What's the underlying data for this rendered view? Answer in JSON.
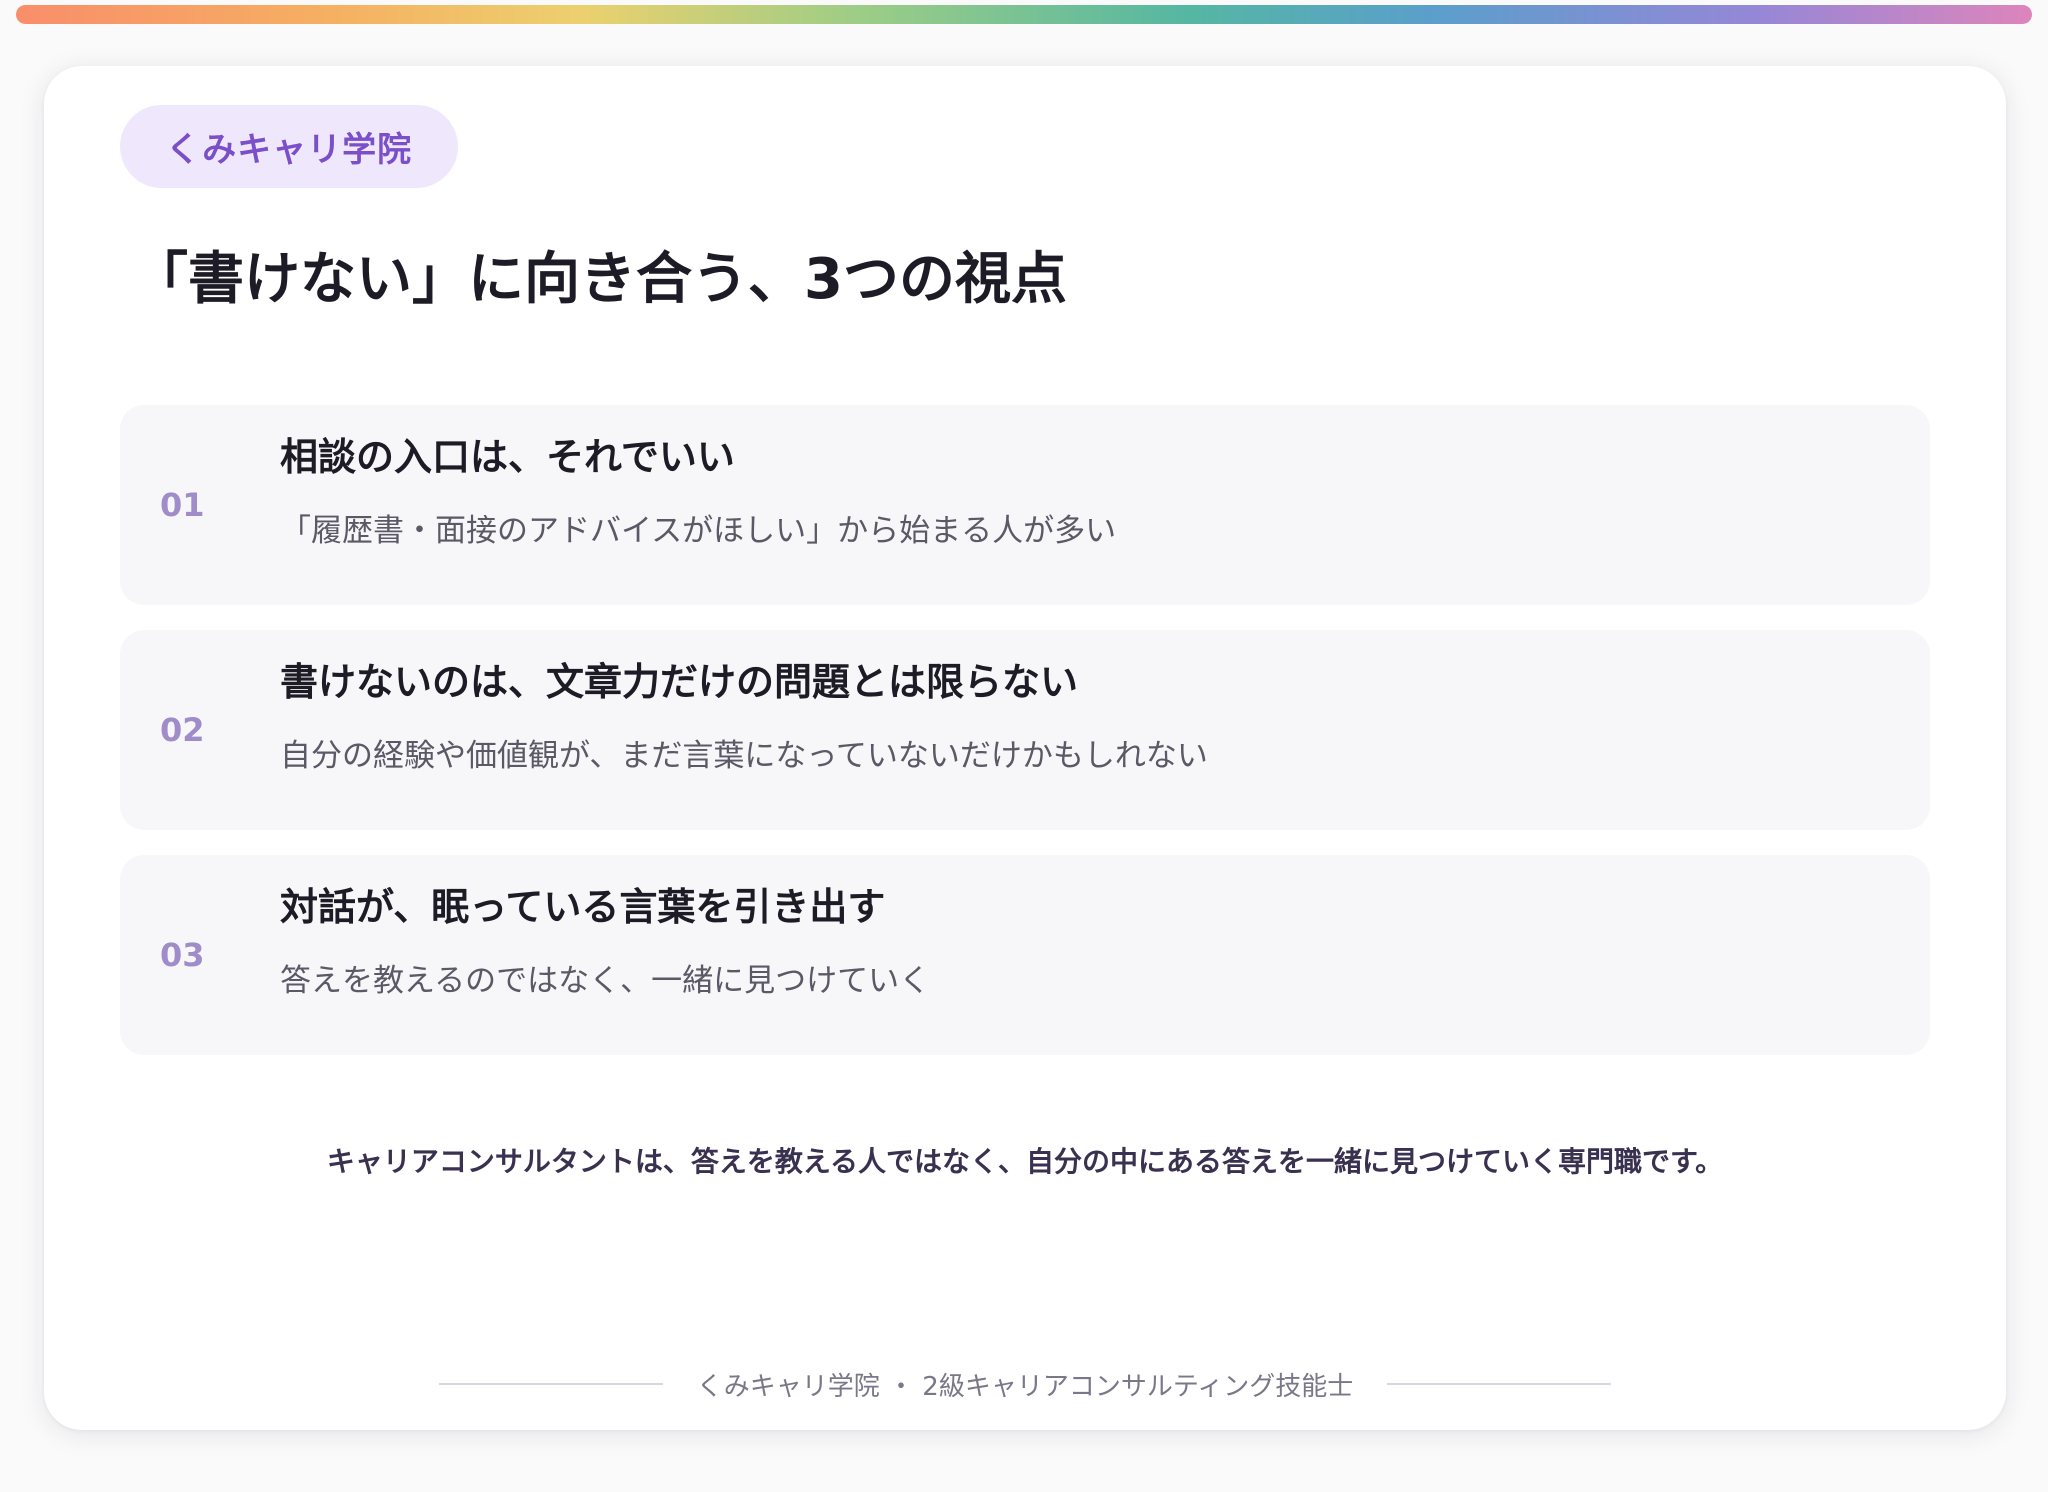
{
  "header": {
    "badge": "くみキャリ学院",
    "title": "「書けない」に向き合う、3つの視点"
  },
  "points": [
    {
      "number": "01",
      "heading": "相談の入口は、それでいい",
      "description": "「履歴書・面接のアドバイスがほしい」から始まる人が多い"
    },
    {
      "number": "02",
      "heading": "書けないのは、文章力だけの問題とは限らない",
      "description": "自分の経験や価値観が、まだ言葉になっていないだけかもしれない"
    },
    {
      "number": "03",
      "heading": "対話が、眠っている言葉を引き出す",
      "description": "答えを教えるのではなく、一緒に見つけていく"
    }
  ],
  "summary": "キャリアコンサルタントは、答えを教える人ではなく、自分の中にある答えを一緒に見つけていく専門職です。",
  "footer": {
    "text": "くみキャリ学院 ・ 2級キャリアコンサルティング技能士"
  },
  "colors": {
    "accent": "#7b4fc9",
    "badge_bg": "#efe8fc",
    "number": "#a08cc8",
    "card_row_bg": "#f7f7f9"
  }
}
